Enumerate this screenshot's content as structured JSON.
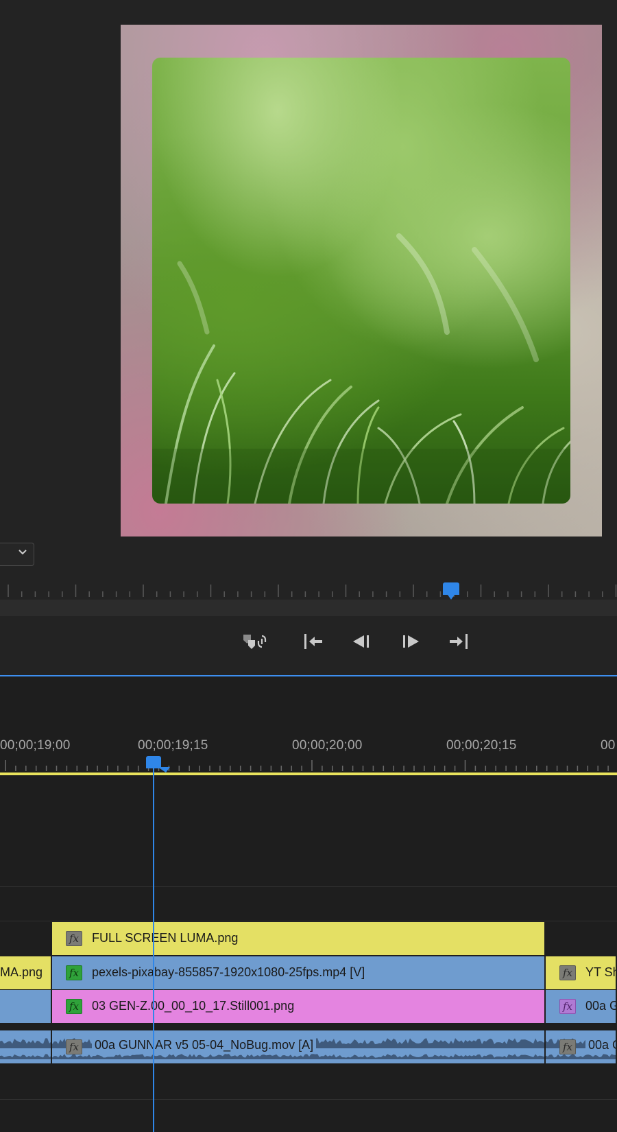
{
  "program_monitor": {
    "format_dropdown_icon": "chevron-down-icon",
    "colors": {
      "playhead": "#2f86e8",
      "frame_border": "#a89a98"
    }
  },
  "transport": {
    "buttons": [
      {
        "name": "add-marker-button",
        "icon": "marker-link-icon"
      },
      {
        "name": "go-to-in-button",
        "icon": "go-to-in-icon"
      },
      {
        "name": "step-back-button",
        "icon": "step-back-icon"
      },
      {
        "name": "step-forward-button",
        "icon": "step-forward-icon"
      },
      {
        "name": "go-to-out-button",
        "icon": "go-to-out-icon"
      }
    ]
  },
  "timeline": {
    "timecodes": [
      "00;00;19;00",
      "00;00;19;15",
      "00;00;20;00",
      "00;00;20;15",
      "00"
    ],
    "colors": {
      "work_area": "#e9e35d",
      "video_clip": "#6f9ccf",
      "adjustment_clip": "#e4e064",
      "graphic_clip": "#e484e0"
    },
    "tracks": {
      "v4": {
        "clips": [
          {
            "name": "FULL SCREEN LUMA.png",
            "fx": "fx",
            "color": "yellow"
          }
        ]
      },
      "v3": {
        "clips": [
          {
            "name": "MA.png",
            "color": "yellow"
          },
          {
            "name": "pexels-pixabay-855857-1920x1080-25fps.mp4 [V]",
            "fx": "fx",
            "color": "blue"
          },
          {
            "name": "YT Sh",
            "fx": "fx",
            "color": "yellow"
          }
        ]
      },
      "v2": {
        "clips": [
          {
            "name": "",
            "color": "blue"
          },
          {
            "name": "03 GEN-Z.00_00_10_17.Still001.png",
            "fx": "fx",
            "color": "pink"
          },
          {
            "name": "00a G",
            "fx": "fx",
            "color": "blue"
          }
        ]
      },
      "a1": {
        "clips": [
          {
            "name": "",
            "color": "blue"
          },
          {
            "name": "00a GUNNAR v5 05-04_NoBug.mov [A]",
            "fx": "fx",
            "color": "blue"
          },
          {
            "name": "00a G",
            "fx": "fx",
            "color": "blue"
          }
        ]
      }
    }
  }
}
